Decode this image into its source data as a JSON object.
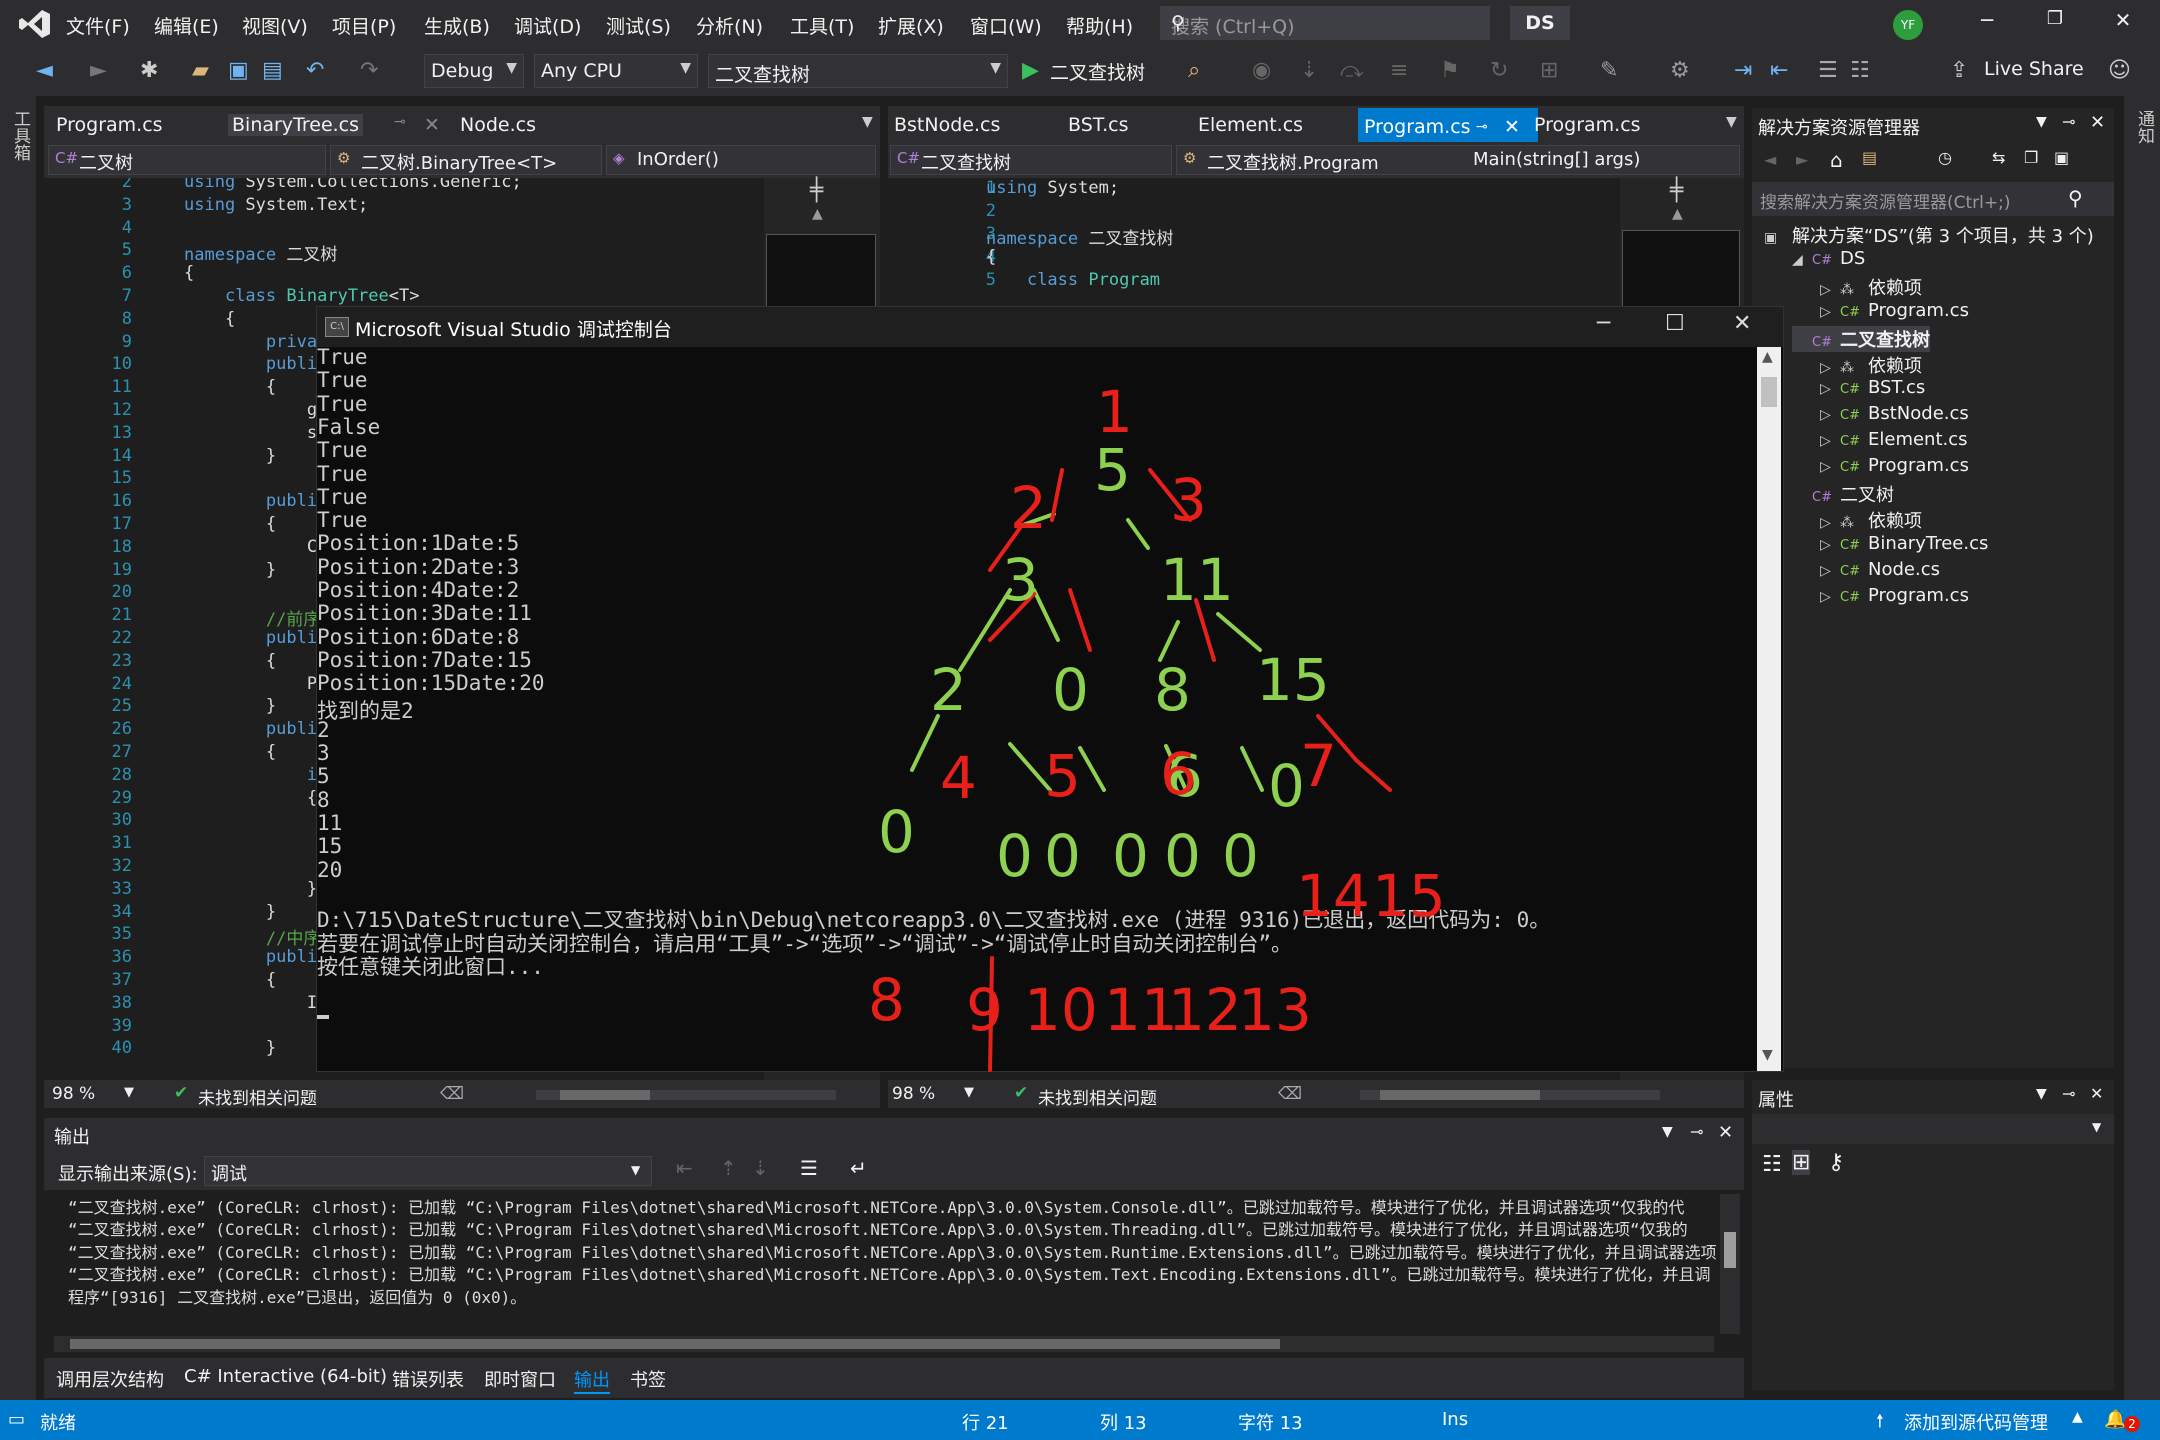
{
  "menu": [
    "文件(F)",
    "编辑(E)",
    "视图(V)",
    "项目(P)",
    "生成(B)",
    "调试(D)",
    "测试(S)",
    "分析(N)",
    "工具(T)",
    "扩展(X)",
    "窗口(W)",
    "帮助(H)"
  ],
  "search": {
    "placeholder": "搜索 (Ctrl+Q)"
  },
  "solution_badge": "DS",
  "avatar_initials": "YF",
  "toolbar": {
    "config": "Debug",
    "platform": "Any CPU",
    "project": "二叉查找树",
    "run_label": "二叉查找树",
    "live_share": "Live Share"
  },
  "left_strip_label": "工具箱",
  "right_strip_label": "通知",
  "left_editor": {
    "tabs": [
      "Program.cs",
      "BinaryTree.cs",
      "Node.cs"
    ],
    "nav": [
      "二叉树",
      "二叉树.BinaryTree<T>",
      "InOrder()"
    ],
    "lines": [
      {
        "n": "2",
        "t": "using System.Collections.Generic;"
      },
      {
        "n": "3",
        "t": "using System.Text;"
      },
      {
        "n": "4",
        "t": ""
      },
      {
        "n": "5",
        "t": "namespace 二叉树"
      },
      {
        "n": "6",
        "t": "{"
      },
      {
        "n": "7",
        "t": "    class BinaryTree<T>"
      },
      {
        "n": "8",
        "t": "    {"
      },
      {
        "n": "9",
        "t": "        privat"
      },
      {
        "n": "10",
        "t": "        public"
      },
      {
        "n": "11",
        "t": "        {"
      },
      {
        "n": "12",
        "t": "            ge"
      },
      {
        "n": "13",
        "t": "            se"
      },
      {
        "n": "14",
        "t": "        }"
      },
      {
        "n": "15",
        "t": ""
      },
      {
        "n": "16",
        "t": "        public"
      },
      {
        "n": "17",
        "t": "        {"
      },
      {
        "n": "18",
        "t": "            Co"
      },
      {
        "n": "19",
        "t": "        }"
      },
      {
        "n": "20",
        "t": ""
      },
      {
        "n": "21",
        "t": "        //前序"
      },
      {
        "n": "22",
        "t": "        public"
      },
      {
        "n": "23",
        "t": "        {"
      },
      {
        "n": "24",
        "t": "            Pe"
      },
      {
        "n": "25",
        "t": "        }"
      },
      {
        "n": "26",
        "t": "        public"
      },
      {
        "n": "27",
        "t": "        {"
      },
      {
        "n": "28",
        "t": "            if"
      },
      {
        "n": "29",
        "t": "            {"
      },
      {
        "n": "30",
        "t": ""
      },
      {
        "n": "31",
        "t": ""
      },
      {
        "n": "32",
        "t": ""
      },
      {
        "n": "33",
        "t": "            }"
      },
      {
        "n": "34",
        "t": "        }"
      },
      {
        "n": "35",
        "t": "        //中序"
      },
      {
        "n": "36",
        "t": "        public"
      },
      {
        "n": "37",
        "t": "        {"
      },
      {
        "n": "38",
        "t": "            In"
      },
      {
        "n": "39",
        "t": ""
      },
      {
        "n": "40",
        "t": "        }"
      }
    ],
    "zoom": "98 %",
    "issues": "未找到相关问题"
  },
  "right_editor": {
    "tabs": [
      "BstNode.cs",
      "BST.cs",
      "Element.cs",
      "Program.cs",
      "Program.cs"
    ],
    "nav": [
      "二叉查找树",
      "二叉查找树.Program",
      "Main(string[] args)"
    ],
    "lines": [
      {
        "n": "1",
        "t": "using System;"
      },
      {
        "n": "2",
        "t": ""
      },
      {
        "n": "3",
        "t": "namespace 二叉查找树"
      },
      {
        "n": "4",
        "t": "{"
      },
      {
        "n": "5",
        "t": "    class Program"
      }
    ],
    "zoom": "98 %",
    "issues": "未找到相关问题"
  },
  "console": {
    "title": "Microsoft Visual Studio 调试控制台",
    "icon_text": "C:\\",
    "lines": [
      "True",
      "True",
      "True",
      "False",
      "True",
      "True",
      "True",
      "True",
      "Position:1Date:5",
      "Position:2Date:3",
      "Position:4Date:2",
      "Position:3Date:11",
      "Position:6Date:8",
      "Position:7Date:15",
      "Position:15Date:20",
      "找到的是2",
      "2",
      "3",
      "5",
      "8",
      "11",
      "15",
      "20",
      "",
      "D:\\715\\DateStructure\\二叉查找树\\bin\\Debug\\netcoreapp3.0\\二叉查找树.exe (进程 9316)已退出，返回代码为: 0。",
      "若要在调试停止时自动关闭控制台，请启用“工具”->“选项”->“调试”->“调试停止时自动关闭控制台”。",
      "按任意键关闭此窗口..."
    ]
  },
  "solution_explorer": {
    "title": "解决方案资源管理器",
    "search_placeholder": "搜索解决方案资源管理器(Ctrl+;)",
    "items": [
      {
        "label": "解决方案“DS”(第 3 个项目，共 3 个)",
        "level": 0,
        "kind": "sln"
      },
      {
        "label": "DS",
        "level": 1,
        "kind": "proj",
        "arrow": "◢"
      },
      {
        "label": "依赖项",
        "level": 2,
        "kind": "dep",
        "arrow": "▷"
      },
      {
        "label": "Program.cs",
        "level": 2,
        "kind": "cs",
        "arrow": "▷"
      },
      {
        "label": "二叉查找树",
        "level": 1,
        "kind": "proj",
        "bold": true
      },
      {
        "label": "依赖项",
        "level": 2,
        "kind": "dep",
        "arrow": "▷"
      },
      {
        "label": "BST.cs",
        "level": 2,
        "kind": "cs",
        "arrow": "▷"
      },
      {
        "label": "BstNode.cs",
        "level": 2,
        "kind": "cs",
        "arrow": "▷"
      },
      {
        "label": "Element.cs",
        "level": 2,
        "kind": "cs",
        "arrow": "▷"
      },
      {
        "label": "Program.cs",
        "level": 2,
        "kind": "cs",
        "arrow": "▷"
      },
      {
        "label": "二叉树",
        "level": 1,
        "kind": "proj"
      },
      {
        "label": "依赖项",
        "level": 2,
        "kind": "dep",
        "arrow": "▷"
      },
      {
        "label": "BinaryTree.cs",
        "level": 2,
        "kind": "cs",
        "arrow": "▷"
      },
      {
        "label": "Node.cs",
        "level": 2,
        "kind": "cs",
        "arrow": "▷"
      },
      {
        "label": "Program.cs",
        "level": 2,
        "kind": "cs",
        "arrow": "▷"
      }
    ]
  },
  "properties": {
    "title": "属性"
  },
  "output": {
    "title": "输出",
    "source_label": "显示输出来源(S):",
    "source_value": "调试",
    "lines": [
      "“二叉查找树.exe” (CoreCLR: clrhost): 已加载 “C:\\Program Files\\dotnet\\shared\\Microsoft.NETCore.App\\3.0.0\\System.Console.dll”。已跳过加载符号。模块进行了优化，并且调试器选项“仅我的代",
      "“二叉查找树.exe” (CoreCLR: clrhost): 已加载 “C:\\Program Files\\dotnet\\shared\\Microsoft.NETCore.App\\3.0.0\\System.Threading.dll”。已跳过加载符号。模块进行了优化，并且调试器选项“仅我的",
      "“二叉查找树.exe” (CoreCLR: clrhost): 已加载 “C:\\Program Files\\dotnet\\shared\\Microsoft.NETCore.App\\3.0.0\\System.Runtime.Extensions.dll”。已跳过加载符号。模块进行了优化，并且调试器选项",
      "“二叉查找树.exe” (CoreCLR: clrhost): 已加载 “C:\\Program Files\\dotnet\\shared\\Microsoft.NETCore.App\\3.0.0\\System.Text.Encoding.Extensions.dll”。已跳过加载符号。模块进行了优化，并且调",
      "程序“[9316] 二叉查找树.exe”已退出，返回值为 0 (0x0)。"
    ]
  },
  "bottom_tabs": [
    "调用层次结构",
    "C# Interactive (64-bit)",
    "错误列表",
    "即时窗口",
    "输出",
    "书签"
  ],
  "status": {
    "ready": "就绪",
    "line": "行 21",
    "col": "列 13",
    "char": "字符 13",
    "mode": "Ins",
    "source_control": "添加到源代码管理",
    "notifications": "2"
  },
  "handwriting": {
    "green_labels": [
      "5",
      "3",
      "11",
      "2",
      "0",
      "8",
      "15",
      "0",
      "6",
      "0",
      "0",
      "0",
      "0",
      "0",
      "0"
    ],
    "red_labels": [
      "1",
      "2",
      "3",
      "4",
      "5",
      "6",
      "7",
      "14",
      "15",
      "8",
      "9",
      "10",
      "11",
      "12",
      "13"
    ],
    "colors": {
      "green": "#8ed04f",
      "red": "#e8201a"
    }
  },
  "colors": {
    "accent": "#007acc",
    "keyword": "#569cd6",
    "class": "#4ec9b0",
    "comment": "#57a64a",
    "line_number": "#2b91af"
  }
}
